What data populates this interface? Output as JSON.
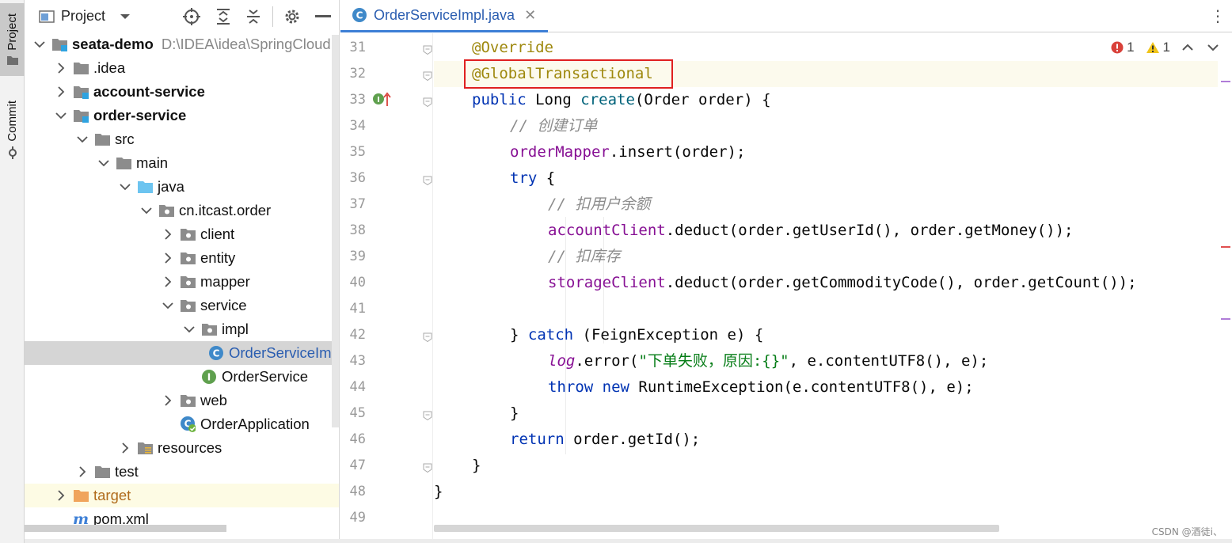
{
  "toolstrip": {
    "project_label": "Project",
    "commit_label": "Commit"
  },
  "project_panel": {
    "title": "Project",
    "tree": [
      {
        "label": "seata-demo",
        "path": "D:\\IDEA\\idea\\SpringCloud",
        "icon": "module-folder-icon",
        "expanded": true,
        "bold": true
      },
      {
        "label": ".idea",
        "icon": "folder-icon",
        "expanded": false
      },
      {
        "label": "account-service",
        "icon": "module-folder-icon",
        "expanded": false,
        "bold": true
      },
      {
        "label": "order-service",
        "icon": "module-folder-icon",
        "expanded": true,
        "bold": true
      },
      {
        "label": "src",
        "icon": "folder-icon",
        "expanded": true
      },
      {
        "label": "main",
        "icon": "folder-icon",
        "expanded": true
      },
      {
        "label": "java",
        "icon": "source-folder-icon",
        "expanded": true
      },
      {
        "label": "cn.itcast.order",
        "icon": "package-icon",
        "expanded": true
      },
      {
        "label": "client",
        "icon": "package-icon",
        "expanded": false
      },
      {
        "label": "entity",
        "icon": "package-icon",
        "expanded": false
      },
      {
        "label": "mapper",
        "icon": "package-icon",
        "expanded": false
      },
      {
        "label": "service",
        "icon": "package-icon",
        "expanded": true
      },
      {
        "label": "impl",
        "icon": "package-icon",
        "expanded": true
      },
      {
        "label": "OrderServiceImpl",
        "icon": "class-icon",
        "selected": true
      },
      {
        "label": "OrderService",
        "icon": "interface-icon"
      },
      {
        "label": "web",
        "icon": "package-icon",
        "expanded": false
      },
      {
        "label": "OrderApplication",
        "icon": "spring-boot-class-icon"
      },
      {
        "label": "resources",
        "icon": "resources-folder-icon",
        "expanded": false
      },
      {
        "label": "test",
        "icon": "folder-icon",
        "expanded": false
      },
      {
        "label": "target",
        "icon": "excluded-folder-icon",
        "expanded": false
      },
      {
        "label": "pom.xml",
        "icon": "maven-icon"
      }
    ]
  },
  "editor": {
    "tab_label": "OrderServiceImpl.java",
    "inspections": {
      "errors": "1",
      "warnings": "1"
    },
    "line_numbers": [
      "31",
      "32",
      "33",
      "34",
      "35",
      "36",
      "37",
      "38",
      "39",
      "40",
      "41",
      "42",
      "43",
      "44",
      "45",
      "46",
      "47",
      "48",
      "49"
    ],
    "lines": {
      "l31": {
        "annotation": "@Override"
      },
      "l32": {
        "annotation": "@GlobalTransactional"
      },
      "l33": {
        "kw": "public",
        "type": " Long ",
        "fn": "create",
        "rest": "(Order order) {"
      },
      "l34": {
        "comment": "// 创建订单"
      },
      "l35": {
        "field": "orderMapper",
        "rest": ".insert(order);"
      },
      "l36": {
        "kw": "try",
        "rest": " {"
      },
      "l37": {
        "comment": "// 扣用户余额"
      },
      "l38": {
        "field": "accountClient",
        "rest": ".deduct(order.getUserId(), order.getMoney());"
      },
      "l39": {
        "comment": "// 扣库存"
      },
      "l40": {
        "field": "storageClient",
        "rest": ".deduct(order.getCommodityCode(), order.getCount());"
      },
      "l42": {
        "pre": "} ",
        "kw": "catch",
        "rest": " (FeignException e) {"
      },
      "l43": {
        "log": "log",
        "mid": ".error(",
        "str": "\"下单失败，原因:{}\"",
        "rest": ", e.contentUTF8(), e);"
      },
      "l44": {
        "kw": "throw",
        "kw2": "new",
        "rest": " RuntimeException(e.contentUTF8(), e);"
      },
      "l45": {
        "rest": "}"
      },
      "l46": {
        "kw": "return",
        "rest": " order.getId();"
      },
      "l47": {
        "rest": "}"
      },
      "l48": {
        "rest": "}"
      }
    }
  },
  "watermark": "CSDN @酒徒i、",
  "colors": {
    "keyword": "#0033b3",
    "annotation": "#9e880d",
    "method": "#00627a",
    "field": "#871094",
    "comment": "#8c8c8c",
    "string": "#067d17",
    "highlight_box": "#e02020",
    "tab_underline": "#3d7fd6"
  }
}
